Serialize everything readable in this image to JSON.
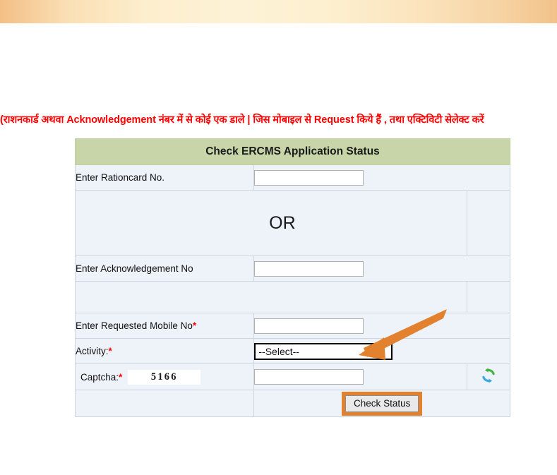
{
  "banner": {
    "gradient_start": "#f3bf86",
    "gradient_mid": "#fdf2d6",
    "gradient_end": "#f2c28a"
  },
  "instruction": {
    "text": "(राशनकार्ड अथवा Acknowledgement नंबर में से कोई एक डाले | जिस मोबाइल से Request किये हैं , तथा एक्टिविटी सेलेक्ट करें",
    "color": "#fe0000"
  },
  "form": {
    "title": "Check ERCMS Application Status",
    "title_bg": "#c7d5a8",
    "rows": {
      "rationcard_label": "Enter Rationcard No.",
      "rationcard_value": "",
      "rationcard_placeholder": "",
      "or_text": "OR",
      "acknowledgement_label": "Enter Acknowledgement No",
      "acknowledgement_value": "",
      "acknowledgement_placeholder": "",
      "mobile_label": "Enter Requested Mobile No",
      "mobile_required_mark": "*",
      "mobile_value": "",
      "mobile_placeholder": "",
      "activity_label": "Activity:",
      "activity_required_mark": "*",
      "activity_selected": "--Select--",
      "activity_options": [
        "--Select--"
      ],
      "captcha_label": "Captcha:",
      "captcha_required_mark": "*",
      "captcha_code": "5166",
      "captcha_value": "",
      "captcha_placeholder": "",
      "refresh_icon": "refresh-captcha-icon"
    },
    "submit_label": "Check Status",
    "submit_highlight_color": "#e3822e"
  },
  "annotation": {
    "arrow_name": "orange-pointer-arrow",
    "arrow_color": "#e3822e",
    "points_to": "activity-select"
  }
}
